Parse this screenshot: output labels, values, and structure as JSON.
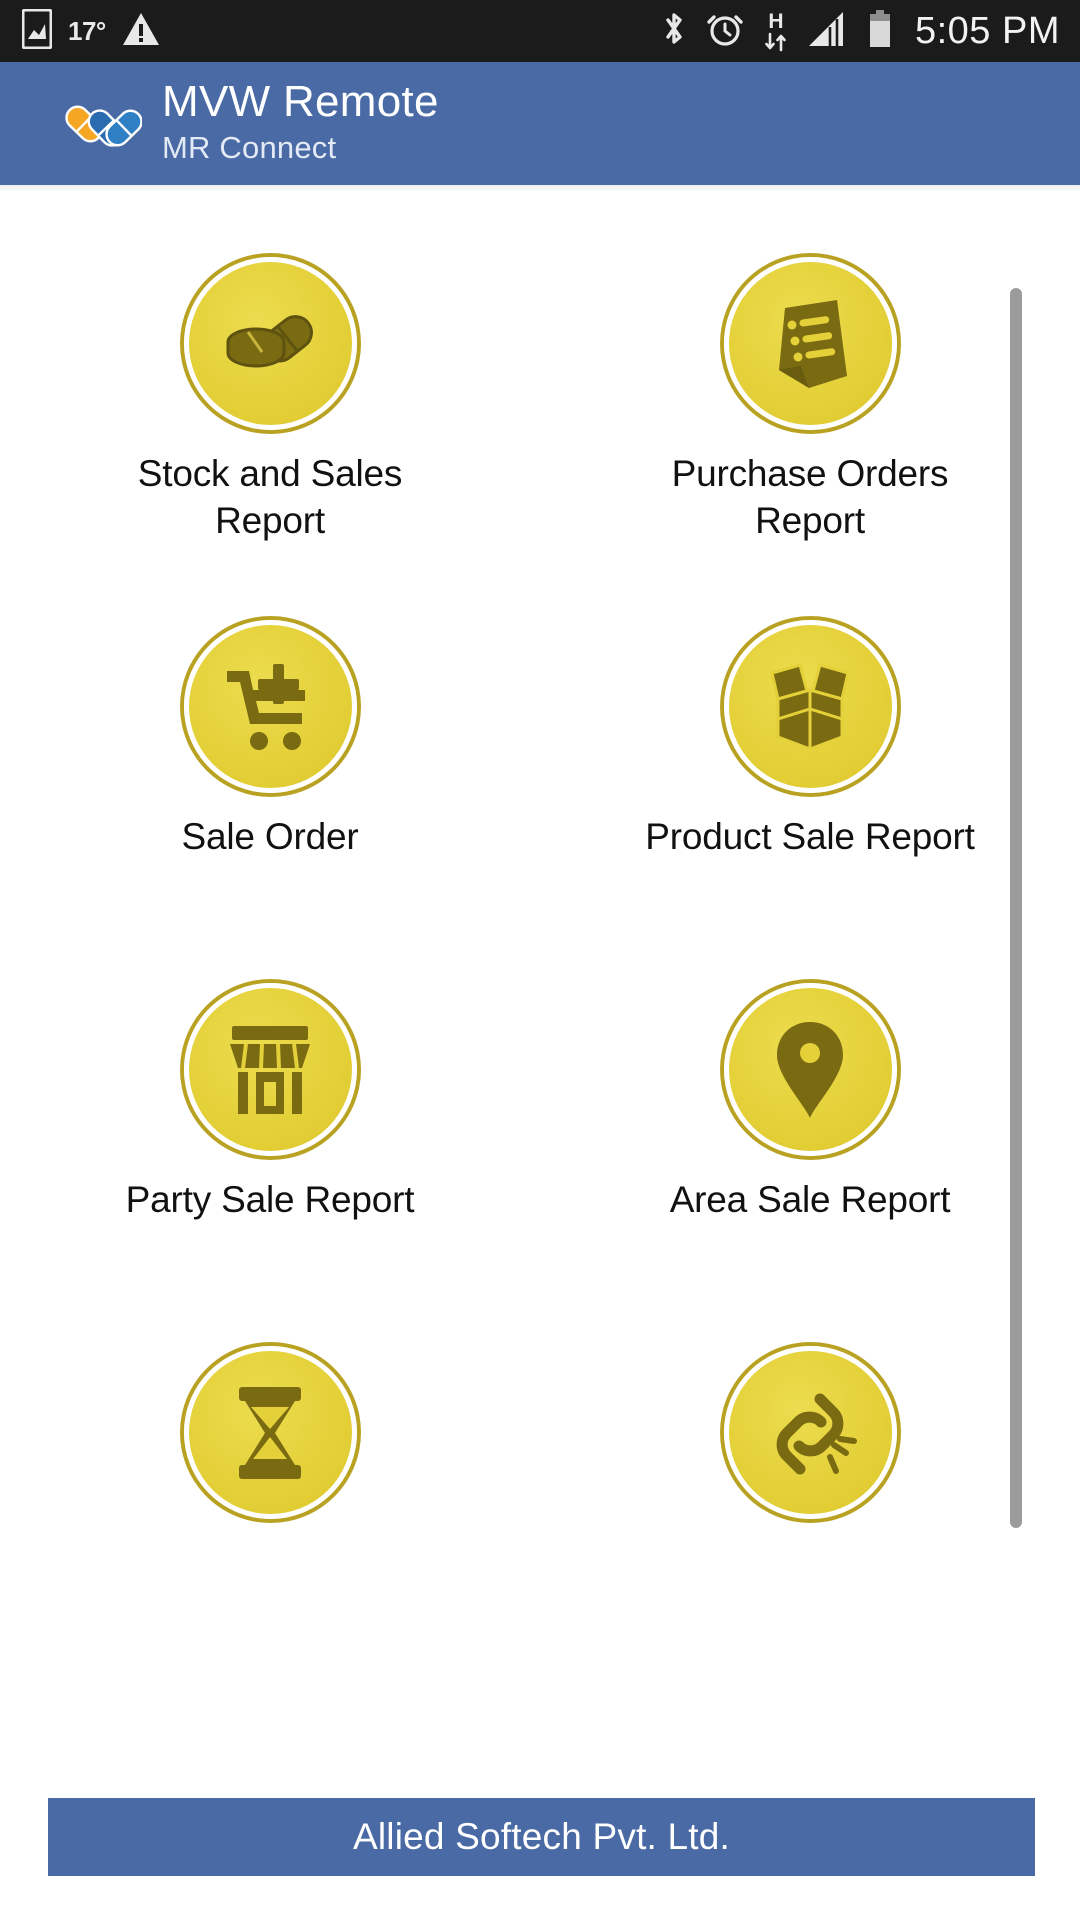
{
  "status_bar": {
    "temperature": "17°",
    "clock": "5:05 PM",
    "network_type": "H",
    "icons": [
      "screenshot-image-icon",
      "warning-triangle-icon",
      "bluetooth-icon",
      "alarm-clock-icon",
      "hspa-data-icon",
      "signal-bars-icon",
      "battery-icon"
    ]
  },
  "header": {
    "title": "MVW Remote",
    "subtitle": "MR Connect",
    "logo_icon": "pill-capsules-logo",
    "background_color": "#4a6aa5"
  },
  "theme": {
    "accent_blue": "#4a6aa5",
    "icon_fill": "#e4d038",
    "icon_ring": "#b9a222",
    "icon_glyph": "#7a6a12",
    "status_bar_bg": "#1b1b1b",
    "page_bg": "#ffffff"
  },
  "grid": {
    "items": [
      {
        "label": "Stock and Sales Report",
        "icon": "pill-capsule-icon"
      },
      {
        "label": "Purchase Orders Report",
        "icon": "invoice-document-icon"
      },
      {
        "label": "Sale Order",
        "icon": "shopping-cart-plus-icon"
      },
      {
        "label": "Product Sale Report",
        "icon": "open-box-icon"
      },
      {
        "label": "Party Sale Report",
        "icon": "storefront-shop-icon"
      },
      {
        "label": "Area Sale Report",
        "icon": "map-pin-location-icon"
      },
      {
        "label": "",
        "icon": "hourglass-icon"
      },
      {
        "label": "",
        "icon": "broken-link-chain-icon"
      }
    ]
  },
  "scrollbar": {
    "visible": true,
    "orientation": "vertical"
  },
  "footer": {
    "text": "Allied Softech Pvt. Ltd.",
    "background_color": "#4a6aa5"
  }
}
